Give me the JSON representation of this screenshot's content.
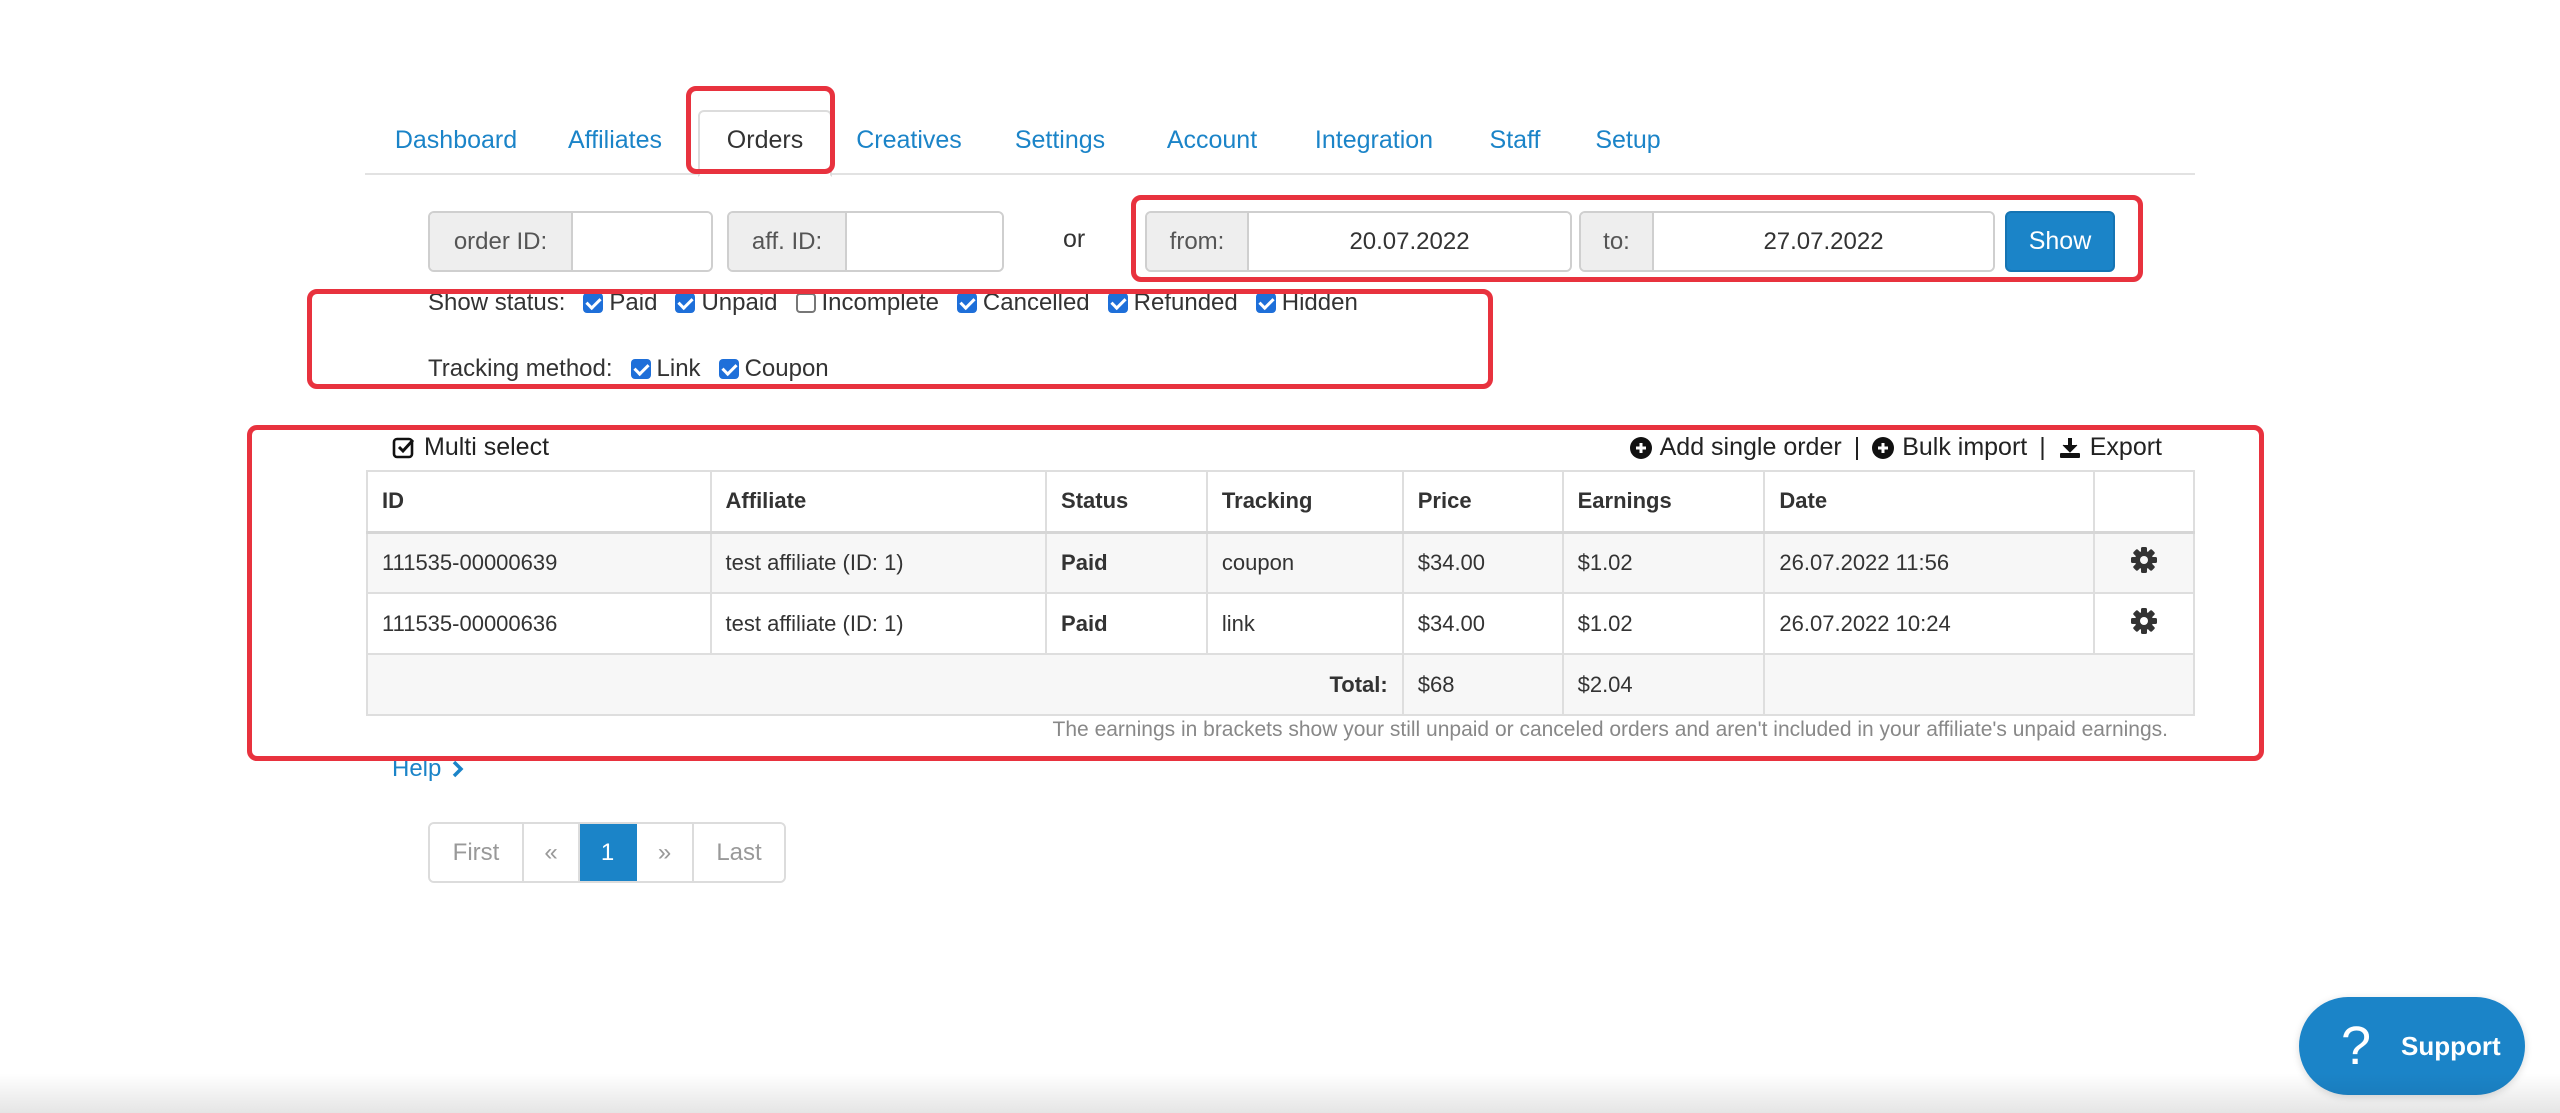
{
  "tabs": [
    {
      "label": "Dashboard"
    },
    {
      "label": "Affiliates"
    },
    {
      "label": "Orders"
    },
    {
      "label": "Creatives"
    },
    {
      "label": "Settings"
    },
    {
      "label": "Account"
    },
    {
      "label": "Integration"
    },
    {
      "label": "Staff"
    },
    {
      "label": "Setup"
    }
  ],
  "filters": {
    "order_id_label": "order ID:",
    "order_id_value": "",
    "aff_id_label": "aff. ID:",
    "aff_id_value": "",
    "or_text": "or",
    "from_label": "from:",
    "from_value": "20.07.2022",
    "to_label": "to:",
    "to_value": "27.07.2022",
    "show_button": "Show"
  },
  "status_filter": {
    "label": "Show status:",
    "options": [
      {
        "label": "Paid",
        "checked": true
      },
      {
        "label": "Unpaid",
        "checked": true
      },
      {
        "label": "Incomplete",
        "checked": false
      },
      {
        "label": "Cancelled",
        "checked": true
      },
      {
        "label": "Refunded",
        "checked": true
      },
      {
        "label": "Hidden",
        "checked": true
      }
    ]
  },
  "tracking_filter": {
    "label": "Tracking method:",
    "options": [
      {
        "label": "Link",
        "checked": true
      },
      {
        "label": "Coupon",
        "checked": true
      }
    ]
  },
  "toolbar": {
    "multi_select": "Multi select",
    "add_single_order": "Add single order",
    "separator": "|",
    "bulk_import": "Bulk import",
    "export": "Export"
  },
  "table": {
    "headers": [
      "ID",
      "Affiliate",
      "Status",
      "Tracking",
      "Price",
      "Earnings",
      "Date",
      ""
    ],
    "rows": [
      {
        "id": "111535-00000639",
        "affiliate": "test affiliate (ID: 1)",
        "status": "Paid",
        "tracking": "coupon",
        "price": "$34.00",
        "earnings": "$1.02",
        "date": "26.07.2022 11:56"
      },
      {
        "id": "111535-00000636",
        "affiliate": "test affiliate (ID: 1)",
        "status": "Paid",
        "tracking": "link",
        "price": "$34.00",
        "earnings": "$1.02",
        "date": "26.07.2022 10:24"
      }
    ],
    "total_label": "Total:",
    "total_price": "$68",
    "total_earnings": "$2.04",
    "note": "The earnings in brackets show your still unpaid or canceled orders and aren't included in your affiliate's unpaid earnings."
  },
  "help": {
    "label": "Help"
  },
  "pagination": {
    "first": "First",
    "prev": "«",
    "current": "1",
    "next": "»",
    "last": "Last"
  },
  "support": {
    "icon": "?",
    "label": "Support"
  },
  "colors": {
    "link": "#1b84c8",
    "highlight": "#e8323e",
    "paid": "#2a8a1e"
  }
}
